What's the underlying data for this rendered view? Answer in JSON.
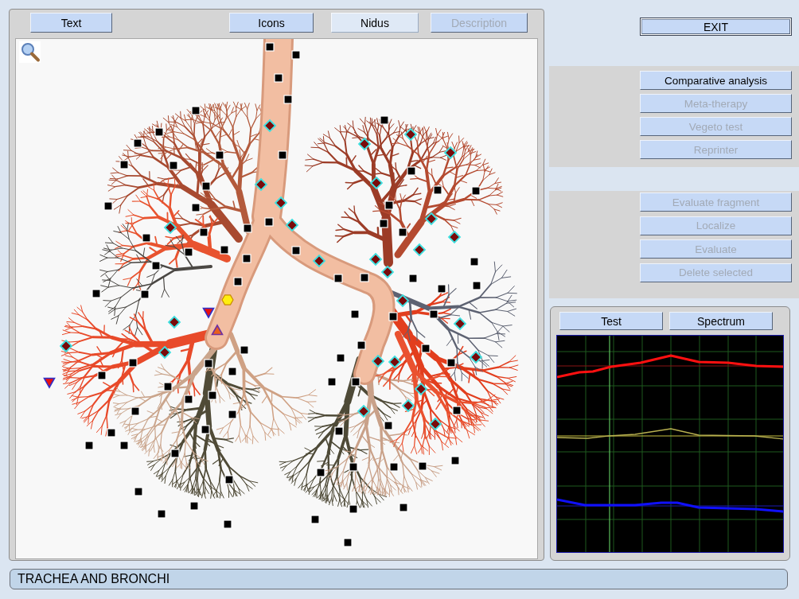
{
  "view_tabs": [
    {
      "label": "Text",
      "selected": false,
      "disabled": false
    },
    {
      "label": "Icons",
      "selected": false,
      "disabled": false
    },
    {
      "label": "Nidus",
      "selected": true,
      "disabled": false
    },
    {
      "label": "Description",
      "selected": false,
      "disabled": true
    }
  ],
  "image_view": {
    "markers": [
      {
        "kind": "square"
      },
      {
        "kind": "square"
      },
      {
        "kind": "square"
      },
      {
        "kind": "square"
      },
      {
        "kind": "square"
      },
      {
        "kind": "square"
      },
      {
        "kind": "diamond"
      },
      {
        "kind": "square"
      },
      {
        "kind": "diamond"
      },
      {
        "kind": "square"
      },
      {
        "kind": "diamond"
      },
      {
        "kind": "diamond"
      },
      {
        "kind": "square"
      },
      {
        "kind": "square"
      },
      {
        "kind": "square"
      },
      {
        "kind": "square"
      },
      {
        "kind": "square"
      },
      {
        "kind": "diamond"
      },
      {
        "kind": "diamond"
      },
      {
        "kind": "square"
      },
      {
        "kind": "square"
      },
      {
        "kind": "square"
      },
      {
        "kind": "diamond"
      },
      {
        "kind": "square"
      },
      {
        "kind": "square"
      },
      {
        "kind": "square"
      },
      {
        "kind": "diamond"
      },
      {
        "kind": "square"
      },
      {
        "kind": "square"
      },
      {
        "kind": "diamond"
      },
      {
        "kind": "diamond"
      },
      {
        "kind": "square"
      },
      {
        "kind": "square"
      },
      {
        "kind": "square"
      },
      {
        "kind": "diamond"
      },
      {
        "kind": "square"
      },
      {
        "kind": "diamond"
      },
      {
        "kind": "square"
      },
      {
        "kind": "square"
      },
      {
        "kind": "square"
      },
      {
        "kind": "square"
      },
      {
        "kind": "diamond"
      },
      {
        "kind": "diamond"
      },
      {
        "kind": "square"
      },
      {
        "kind": "square"
      },
      {
        "kind": "diamond"
      },
      {
        "kind": "square"
      },
      {
        "kind": "square"
      },
      {
        "kind": "square"
      },
      {
        "kind": "square"
      },
      {
        "kind": "square"
      },
      {
        "kind": "square"
      },
      {
        "kind": "square"
      },
      {
        "kind": "square"
      },
      {
        "kind": "hexagon"
      },
      {
        "kind": "diamond"
      },
      {
        "kind": "triangle-down"
      },
      {
        "kind": "square"
      },
      {
        "kind": "square"
      },
      {
        "kind": "square"
      },
      {
        "kind": "diamond"
      },
      {
        "kind": "diamond"
      },
      {
        "kind": "triangle-up"
      },
      {
        "kind": "diamond"
      },
      {
        "kind": "square"
      },
      {
        "kind": "diamond"
      },
      {
        "kind": "diamond"
      },
      {
        "kind": "square"
      },
      {
        "kind": "square"
      },
      {
        "kind": "square"
      },
      {
        "kind": "diamond"
      },
      {
        "kind": "diamond"
      },
      {
        "kind": "square"
      },
      {
        "kind": "square"
      },
      {
        "kind": "square"
      },
      {
        "kind": "square"
      },
      {
        "kind": "square"
      },
      {
        "kind": "triangle-down"
      },
      {
        "kind": "square"
      },
      {
        "kind": "square"
      },
      {
        "kind": "square"
      },
      {
        "kind": "diamond"
      },
      {
        "kind": "square"
      },
      {
        "kind": "square"
      },
      {
        "kind": "diamond"
      },
      {
        "kind": "square"
      },
      {
        "kind": "diamond"
      },
      {
        "kind": "square"
      },
      {
        "kind": "square"
      },
      {
        "kind": "diamond"
      },
      {
        "kind": "square"
      },
      {
        "kind": "square"
      },
      {
        "kind": "square"
      },
      {
        "kind": "square"
      },
      {
        "kind": "square"
      },
      {
        "kind": "square"
      },
      {
        "kind": "square"
      },
      {
        "kind": "square"
      },
      {
        "kind": "square"
      },
      {
        "kind": "square"
      },
      {
        "kind": "square"
      },
      {
        "kind": "square"
      },
      {
        "kind": "square"
      },
      {
        "kind": "square"
      },
      {
        "kind": "square"
      },
      {
        "kind": "square"
      },
      {
        "kind": "square"
      },
      {
        "kind": "square"
      },
      {
        "kind": "square"
      },
      {
        "kind": "square"
      },
      {
        "kind": "square"
      }
    ]
  },
  "exit_button": {
    "label": "EXIT"
  },
  "analysis_buttons": [
    {
      "label": "Comparative analysis",
      "disabled": false
    },
    {
      "label": "Meta-therapy",
      "disabled": true
    },
    {
      "label": "Vegeto test",
      "disabled": true
    },
    {
      "label": "Reprinter",
      "disabled": true
    }
  ],
  "fragment_buttons": [
    {
      "label": "Evaluate fragment",
      "disabled": true
    },
    {
      "label": "Localize",
      "disabled": true
    },
    {
      "label": "Evaluate",
      "disabled": true
    },
    {
      "label": "Delete selected",
      "disabled": true
    }
  ],
  "graph_panel": {
    "buttons": [
      "Test",
      "Spectrum"
    ]
  },
  "status_bar": {
    "text": "TRACHEA AND BRONCHI"
  }
}
